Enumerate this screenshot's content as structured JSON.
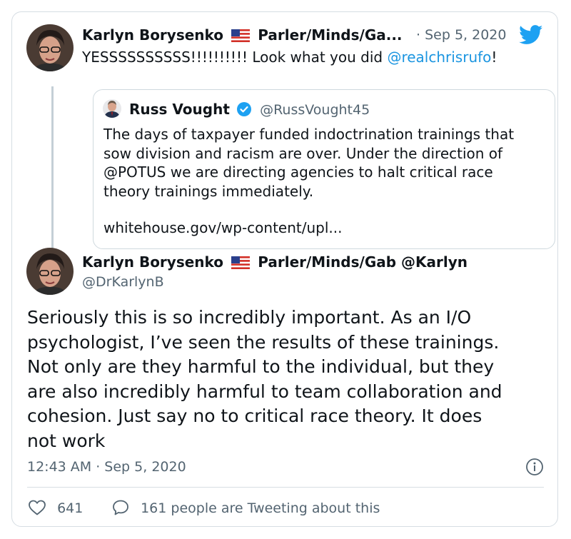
{
  "reply": {
    "display_name": "Karlyn Borysenko",
    "name_suffix": "Parler/Minds/Ga...",
    "separator": "·",
    "date": "Sep 5, 2020",
    "text_prefix": "YESSSSSSSSSS!!!!!!!!!! Look what you did ",
    "mention": "@realchrisrufo",
    "text_suffix": "!"
  },
  "quoted": {
    "display_name": "Russ Vought",
    "handle": "@RussVought45",
    "lines": [
      "The days of taxpayer funded indoctrination trainings that",
      "sow division and racism are over. Under the direction of",
      "@POTUS we are directing agencies to halt critical race",
      "theory trainings immediately."
    ],
    "link": "whitehouse.gov/wp-content/upl..."
  },
  "main": {
    "display_name": "Karlyn Borysenko",
    "name_suffix": "Parler/Minds/Gab @Karlyn",
    "handle": "@DrKarlynB",
    "lines": [
      "Seriously this is so incredibly important. As an I/O",
      "psychologist, I’ve seen the results of these trainings.",
      "Not only are they harmful to the individual, but they",
      "are also incredibly harmful to team collaboration and",
      "cohesion. Just say no to critical race theory. It does",
      "not work"
    ],
    "timestamp": "12:43 AM · Sep 5, 2020"
  },
  "actions": {
    "likes": "641",
    "conversation": "161 people are Tweeting about this"
  },
  "icons": {
    "brand": "twitter-bird-icon",
    "verified": "verified-badge-icon",
    "info": "info-icon",
    "like": "heart-icon",
    "reply": "speech-bubble-icon",
    "flag": "us-flag-icon"
  },
  "colors": {
    "accent": "#1da1f2",
    "link": "#1b95e0",
    "muted": "#536471",
    "border": "#cfd9de"
  }
}
